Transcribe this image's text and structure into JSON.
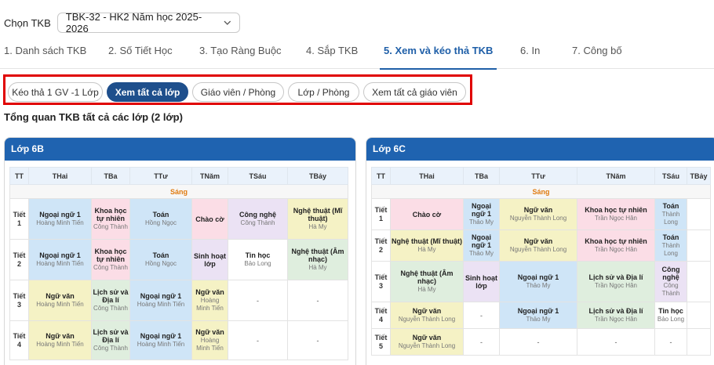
{
  "top": {
    "label": "Chọn TKB",
    "selected": "TBK-32 - HK2 Năm học 2025-2026"
  },
  "tabs": [
    {
      "label": "1. Danh sách TKB",
      "active": false
    },
    {
      "label": "2. Số Tiết Học",
      "active": false
    },
    {
      "label": "3. Tạo Ràng Buộc",
      "active": false
    },
    {
      "label": "4. Sắp TKB",
      "active": false
    },
    {
      "label": "5. Xem và kéo thả TKB",
      "active": true
    },
    {
      "label": "6. In",
      "active": false
    },
    {
      "label": "7. Công bố",
      "active": false
    }
  ],
  "modes": [
    {
      "label": "Kéo thả 1 GV -1 Lớp",
      "active": false
    },
    {
      "label": "Xem tất cả lớp",
      "active": true
    },
    {
      "label": "Giáo viên / Phòng",
      "active": false
    },
    {
      "label": "Lớp / Phòng",
      "active": false
    },
    {
      "label": "Xem tất cả giáo viên",
      "active": false
    }
  ],
  "overview_title": "Tổng quan TKB tất cả các lớp (2 lớp)",
  "colors": {
    "accent": "#1f5fa8",
    "header": "#1f63b0",
    "highlight": "#e00000",
    "session": "#e07b10"
  },
  "classes": [
    {
      "name": "Lớp 6B",
      "headers": [
        "TT",
        "THai",
        "TBa",
        "TTư",
        "TNăm",
        "TSáu",
        "TBảy"
      ],
      "session": "Sáng",
      "rows": [
        {
          "tiet": "Tiết 1",
          "cells": [
            {
              "subject": "Ngoại ngữ 1",
              "teacher": "Hoàng Minh Tiến",
              "color": "c-blue"
            },
            {
              "subject": "Khoa học tự nhiên",
              "teacher": "Công Thành",
              "color": "c-pink"
            },
            {
              "subject": "Toán",
              "teacher": "Hồng Ngọc",
              "color": "c-blue"
            },
            {
              "subject": "Chào cờ",
              "teacher": "",
              "color": "c-pink"
            },
            {
              "subject": "Công nghệ",
              "teacher": "Công Thành",
              "color": "c-lav"
            },
            {
              "subject": "Nghệ thuật (Mĩ thuật)",
              "teacher": "Hà My",
              "color": "c-yellow"
            }
          ]
        },
        {
          "tiet": "Tiết 2",
          "cells": [
            {
              "subject": "Ngoại ngữ 1",
              "teacher": "Hoàng Minh Tiến",
              "color": "c-blue"
            },
            {
              "subject": "Khoa học tự nhiên",
              "teacher": "Công Thành",
              "color": "c-pink"
            },
            {
              "subject": "Toán",
              "teacher": "Hồng Ngọc",
              "color": "c-blue"
            },
            {
              "subject": "Sinh hoạt lớp",
              "teacher": "",
              "color": "c-lav"
            },
            {
              "subject": "Tin học",
              "teacher": "Bảo Long",
              "color": "c-white"
            },
            {
              "subject": "Nghệ thuật (Âm nhạc)",
              "teacher": "Hà My",
              "color": "c-green"
            }
          ]
        },
        {
          "tiet": "Tiết 3",
          "cells": [
            {
              "subject": "Ngữ văn",
              "teacher": "Hoàng Minh Tiến",
              "color": "c-yellow"
            },
            {
              "subject": "Lịch sử và Địa lí",
              "teacher": "Công Thành",
              "color": "c-green"
            },
            {
              "subject": "Ngoại ngữ 1",
              "teacher": "Hoàng Minh Tiến",
              "color": "c-blue"
            },
            {
              "subject": "Ngữ văn",
              "teacher": "Hoàng Minh Tiến",
              "color": "c-yellow"
            },
            {
              "subject": "-",
              "teacher": "",
              "color": "c-white"
            },
            {
              "subject": "-",
              "teacher": "",
              "color": "c-white"
            }
          ]
        },
        {
          "tiet": "Tiết 4",
          "cells": [
            {
              "subject": "Ngữ văn",
              "teacher": "Hoàng Minh Tiến",
              "color": "c-yellow"
            },
            {
              "subject": "Lịch sử và Địa lí",
              "teacher": "Công Thành",
              "color": "c-green"
            },
            {
              "subject": "Ngoại ngữ 1",
              "teacher": "Hoàng Minh Tiến",
              "color": "c-blue"
            },
            {
              "subject": "Ngữ văn",
              "teacher": "Hoàng Minh Tiến",
              "color": "c-yellow"
            },
            {
              "subject": "-",
              "teacher": "",
              "color": "c-white"
            },
            {
              "subject": "-",
              "teacher": "",
              "color": "c-white"
            }
          ]
        }
      ]
    },
    {
      "name": "Lớp 6C",
      "headers": [
        "TT",
        "THai",
        "TBa",
        "TTư",
        "TNăm",
        "TSáu",
        "TBảy"
      ],
      "session": "Sáng",
      "rows": [
        {
          "tiet": "Tiết 1",
          "cells": [
            {
              "subject": "Chào cờ",
              "teacher": "",
              "color": "c-pink"
            },
            {
              "subject": "Ngoại ngữ 1",
              "teacher": "Thảo My",
              "color": "c-blue"
            },
            {
              "subject": "Ngữ văn",
              "teacher": "Nguyễn Thành Long",
              "color": "c-yellow"
            },
            {
              "subject": "Khoa học tự nhiên",
              "teacher": "Trần Ngọc Hân",
              "color": "c-pink"
            },
            {
              "subject": "Toán",
              "teacher": "Thành Long",
              "color": "c-blue"
            },
            {
              "subject": "",
              "teacher": "",
              "color": "c-white"
            }
          ]
        },
        {
          "tiet": "Tiết 2",
          "cells": [
            {
              "subject": "Nghệ thuật (Mĩ thuật)",
              "teacher": "Hà My",
              "color": "c-yellow"
            },
            {
              "subject": "Ngoại ngữ 1",
              "teacher": "Thảo My",
              "color": "c-blue"
            },
            {
              "subject": "Ngữ văn",
              "teacher": "Nguyễn Thành Long",
              "color": "c-yellow"
            },
            {
              "subject": "Khoa học tự nhiên",
              "teacher": "Trần Ngọc Hân",
              "color": "c-pink"
            },
            {
              "subject": "Toán",
              "teacher": "Thành Long",
              "color": "c-blue"
            },
            {
              "subject": "",
              "teacher": "",
              "color": "c-white"
            }
          ]
        },
        {
          "tiet": "Tiết 3",
          "cells": [
            {
              "subject": "Nghệ thuật (Âm nhạc)",
              "teacher": "Hà My",
              "color": "c-green"
            },
            {
              "subject": "Sinh hoạt lớp",
              "teacher": "",
              "color": "c-lav"
            },
            {
              "subject": "Ngoại ngữ 1",
              "teacher": "Thảo My",
              "color": "c-blue"
            },
            {
              "subject": "Lịch sử và Địa lí",
              "teacher": "Trần Ngọc Hân",
              "color": "c-green"
            },
            {
              "subject": "Công nghệ",
              "teacher": "Công Thành",
              "color": "c-lav"
            },
            {
              "subject": "",
              "teacher": "",
              "color": "c-white"
            }
          ]
        },
        {
          "tiet": "Tiết 4",
          "cells": [
            {
              "subject": "Ngữ văn",
              "teacher": "Nguyễn Thành Long",
              "color": "c-yellow"
            },
            {
              "subject": "-",
              "teacher": "",
              "color": "c-white"
            },
            {
              "subject": "Ngoại ngữ 1",
              "teacher": "Thảo My",
              "color": "c-blue"
            },
            {
              "subject": "Lịch sử và Địa lí",
              "teacher": "Trần Ngọc Hân",
              "color": "c-green"
            },
            {
              "subject": "Tin học",
              "teacher": "Bảo Long",
              "color": "c-white"
            },
            {
              "subject": "",
              "teacher": "",
              "color": "c-white"
            }
          ]
        },
        {
          "tiet": "Tiết 5",
          "cells": [
            {
              "subject": "Ngữ văn",
              "teacher": "Nguyễn Thành Long",
              "color": "c-yellow"
            },
            {
              "subject": "-",
              "teacher": "",
              "color": "c-white"
            },
            {
              "subject": "-",
              "teacher": "",
              "color": "c-white"
            },
            {
              "subject": "-",
              "teacher": "",
              "color": "c-white"
            },
            {
              "subject": "-",
              "teacher": "",
              "color": "c-white"
            },
            {
              "subject": "",
              "teacher": "",
              "color": "c-white"
            }
          ]
        }
      ]
    }
  ]
}
